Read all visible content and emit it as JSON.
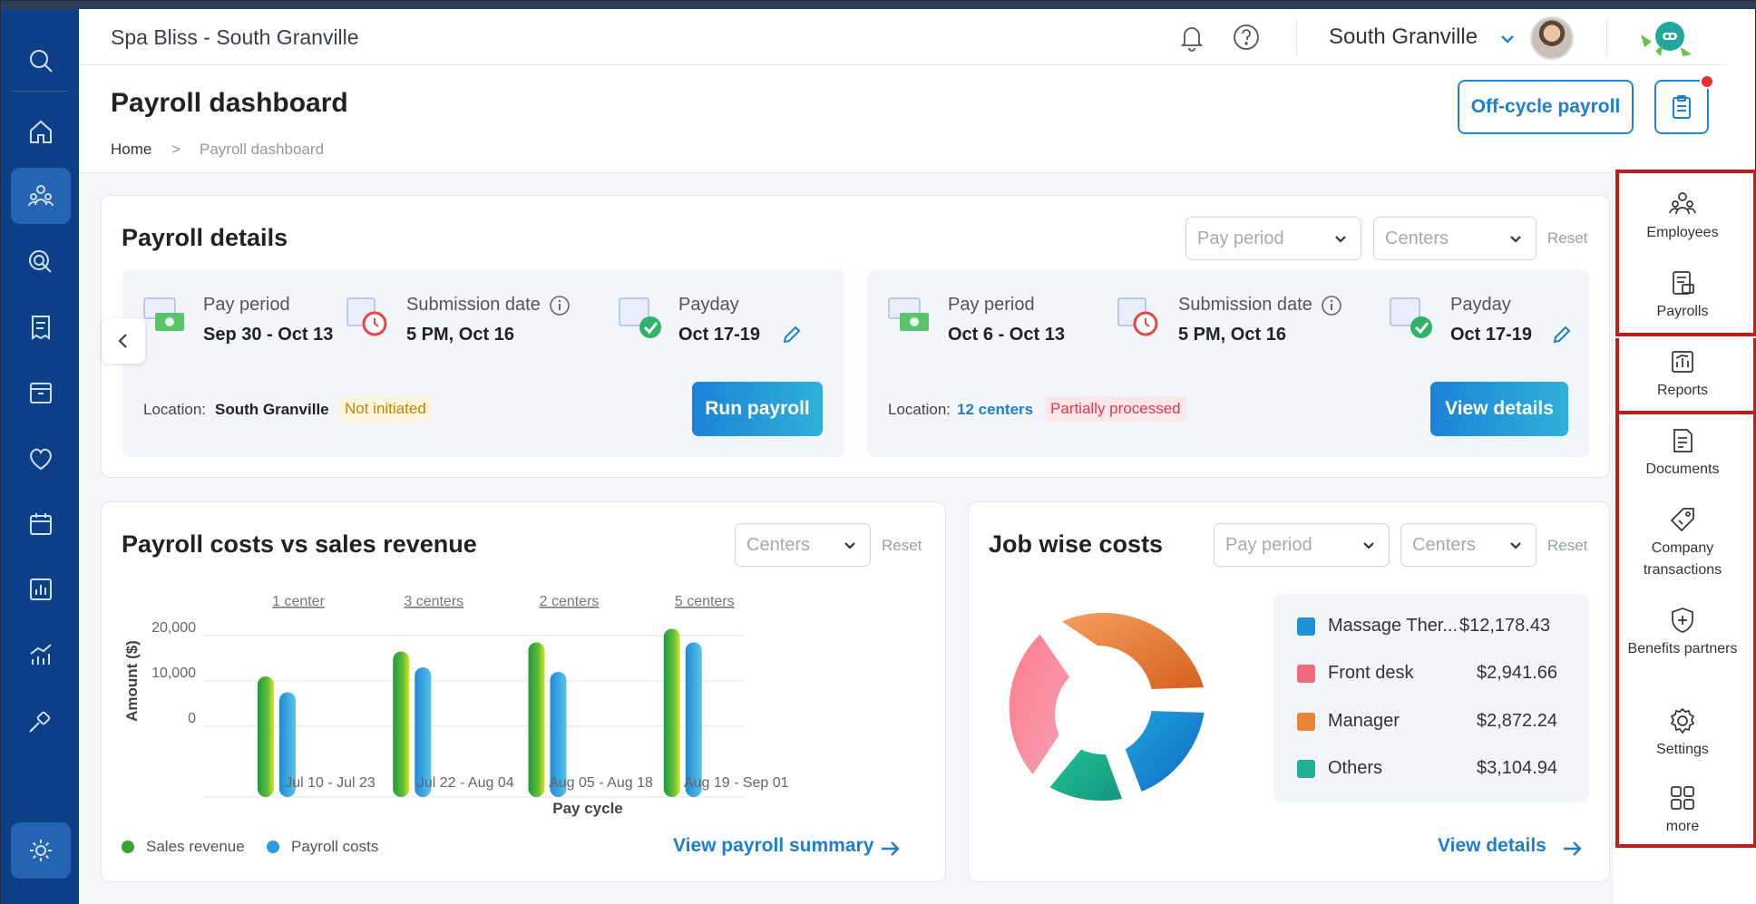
{
  "header": {
    "title": "Spa Bliss - South Granville",
    "location": "South Granville"
  },
  "page": {
    "title": "Payroll dashboard",
    "breadcrumb": {
      "home": "Home",
      "current": "Payroll dashboard"
    },
    "offcycle_label": "Off-cycle payroll"
  },
  "payroll_details": {
    "title": "Payroll details",
    "filters": {
      "pay_period_placeholder": "Pay period",
      "centers_placeholder": "Centers",
      "reset": "Reset"
    },
    "cards": [
      {
        "pay_period_label": "Pay period",
        "pay_period": "Sep 30 - Oct 13",
        "submission_label": "Submission date",
        "submission": "5 PM, Oct 16",
        "payday_label": "Payday",
        "payday": "Oct 17-19",
        "location_label": "Location:",
        "location": "South Granville",
        "status": "Not initiated",
        "action": "Run payroll"
      },
      {
        "pay_period_label": "Pay period",
        "pay_period": "Oct 6 - Oct 13",
        "submission_label": "Submission date",
        "submission": "5 PM, Oct 16",
        "payday_label": "Payday",
        "payday": "Oct 17-19",
        "location_label": "Location:",
        "location": "12 centers",
        "status": "Partially processed",
        "action": "View details"
      }
    ]
  },
  "costs_chart": {
    "title": "Payroll costs vs sales revenue",
    "filter_placeholder": "Centers",
    "reset": "Reset",
    "link": "View payroll summary",
    "colors": {
      "sales": "#3aa336",
      "payroll": "#2c9be0"
    }
  },
  "chart_data": {
    "type": "bar",
    "ylabel": "Amount ($)",
    "xlabel": "Pay cycle",
    "yticks": [
      "20,000",
      "10,000",
      "0"
    ],
    "ylim": [
      -10000,
      20000
    ],
    "categories": [
      "Jul 10 - Jul 23",
      "Jul 22 - Aug 04",
      "Aug 05 - Aug 18",
      "Aug 19 - Sep 01"
    ],
    "group_labels": [
      "1 center",
      "3 centers",
      "2 centers",
      "5 centers"
    ],
    "series": [
      {
        "name": "Sales revenue",
        "values": [
          11000,
          16500,
          18500,
          21500
        ]
      },
      {
        "name": "Payroll costs",
        "values": [
          7500,
          13000,
          12000,
          18500
        ]
      }
    ]
  },
  "job_costs": {
    "title": "Job wise costs",
    "filters": {
      "pay_period_placeholder": "Pay period",
      "centers_placeholder": "Centers",
      "reset": "Reset"
    },
    "items": [
      {
        "name": "Massage Ther...",
        "value": "$12,178.43",
        "color": "#1f8fd6"
      },
      {
        "name": "Front desk",
        "value": "$2,941.66",
        "color": "#f06a7e"
      },
      {
        "name": "Manager",
        "value": "$2,872.24",
        "color": "#e8843a"
      },
      {
        "name": "Others",
        "value": "$3,104.94",
        "color": "#1fb394"
      }
    ],
    "link": "View details"
  },
  "right_rail": {
    "items": [
      "Employees",
      "Payrolls",
      "Reports",
      "Documents",
      "Company transactions",
      "Benefits partners",
      "Settings",
      "more"
    ]
  }
}
